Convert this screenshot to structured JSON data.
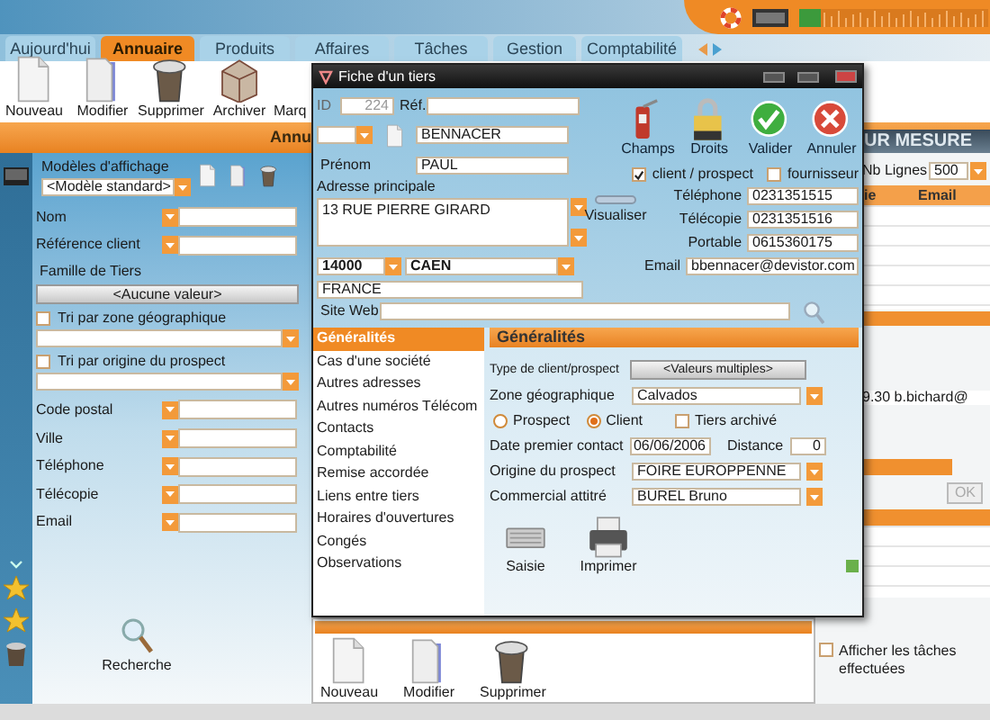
{
  "tabs": [
    {
      "label": "Aujourd'hui",
      "selected": false
    },
    {
      "label": "Annuaire",
      "selected": true
    },
    {
      "label": "Produits",
      "selected": false
    },
    {
      "label": "Affaires",
      "selected": false
    },
    {
      "label": "Tâches",
      "selected": false
    },
    {
      "label": "Gestion",
      "selected": false
    },
    {
      "label": "Comptabilité",
      "selected": false
    }
  ],
  "toolbar": [
    {
      "label": "Nouveau",
      "kind": "new"
    },
    {
      "label": "Modifier",
      "kind": "edit"
    },
    {
      "label": "Supprimer",
      "kind": "delete"
    },
    {
      "label": "Archiver",
      "kind": "archive"
    },
    {
      "label": "Marq",
      "kind": "text"
    }
  ],
  "section_title": "Annu",
  "right_section_title": "UR MESURE",
  "search_panel": {
    "display_models_label": "Modèles d'affichage",
    "display_model": "<Modèle standard>",
    "criteria_top": [
      {
        "label": "Nom"
      },
      {
        "label": "Référence client"
      }
    ],
    "family_label": "Famille de Tiers",
    "family_button": "<Aucune valeur>",
    "sorts": [
      {
        "label": "Tri par zone géographique",
        "checked": false
      },
      {
        "label": "Tri par origine du prospect",
        "checked": false
      }
    ],
    "criteria": [
      {
        "label": "Code postal"
      },
      {
        "label": "Ville"
      },
      {
        "label": "Téléphone"
      },
      {
        "label": "Télécopie"
      },
      {
        "label": "Email"
      }
    ],
    "search_button": "Recherche"
  },
  "list": {
    "rows_label": "Nb Lignes",
    "rows_value": "500",
    "columns": [
      "ie",
      "Email"
    ],
    "visible_cell": "9.30 b.bichard@",
    "ok_button": "OK"
  },
  "bottom_toolbar": [
    {
      "label": "Nouveau",
      "kind": "new"
    },
    {
      "label": "Modifier",
      "kind": "edit"
    },
    {
      "label": "Supprimer",
      "kind": "delete"
    }
  ],
  "show_done_tasks": {
    "label": "Afficher les tâches effectuées",
    "checked": false
  },
  "dialog": {
    "title": "Fiche d'un tiers",
    "id_label": "ID",
    "id": "224",
    "ref_label": "Réf.",
    "name": "BENNACER",
    "first_name_label": "Prénom",
    "first_name": "PAUL",
    "address_label": "Adresse principale",
    "address": "13 RUE PIERRE GIRARD",
    "postcode": "14000",
    "city": "CAEN",
    "country": "FRANCE",
    "website_label": "Site Web",
    "actions": [
      {
        "label": "Champs",
        "kind": "fields"
      },
      {
        "label": "Droits",
        "kind": "rights"
      },
      {
        "label": "Valider",
        "kind": "confirm"
      },
      {
        "label": "Annuler",
        "kind": "cancel"
      }
    ],
    "roles": [
      {
        "label": "client / prospect",
        "checked": true
      },
      {
        "label": "fournisseur",
        "checked": false
      }
    ],
    "view_label": "Visualiser",
    "contacts": [
      {
        "label": "Téléphone",
        "value": "0231351515"
      },
      {
        "label": "Télécopie",
        "value": "0231351516"
      },
      {
        "label": "Portable",
        "value": "0615360175"
      },
      {
        "label": "Email",
        "value": "bbennacer@devistor.com"
      }
    ],
    "nav": [
      {
        "label": "Généralités",
        "selected": true
      },
      {
        "label": "Cas d'une société",
        "selected": false
      },
      {
        "label": "Autres adresses",
        "selected": false
      },
      {
        "label": "Autres numéros Télécom",
        "selected": false
      },
      {
        "label": "Contacts",
        "selected": false
      },
      {
        "label": "Comptabilité",
        "selected": false
      },
      {
        "label": "Remise accordée",
        "selected": false
      },
      {
        "label": "Liens entre tiers",
        "selected": false
      },
      {
        "label": "Horaires d'ouvertures",
        "selected": false
      },
      {
        "label": "Congés",
        "selected": false
      },
      {
        "label": "Observations",
        "selected": false
      }
    ],
    "panel": {
      "title": "Généralités",
      "client_type_label": "Type de client/prospect",
      "client_type": "<Valeurs multiples>",
      "zone_label": "Zone géographique",
      "zone": "Calvados",
      "types": [
        {
          "label": "Prospect",
          "selected": false
        },
        {
          "label": "Client",
          "selected": true
        }
      ],
      "archived": {
        "label": "Tiers archivé",
        "checked": false
      },
      "first_contact_label": "Date premier contact",
      "first_contact": "06/06/2006",
      "distance_label": "Distance",
      "distance": "0",
      "origin_label": "Origine du prospect",
      "origin": "FOIRE EUROPPENNE",
      "sales_label": "Commercial attitré",
      "sales": "BUREL Bruno",
      "tools": [
        {
          "label": "Saisie",
          "kind": "keyboard"
        },
        {
          "label": "Imprimer",
          "kind": "print"
        }
      ]
    }
  }
}
